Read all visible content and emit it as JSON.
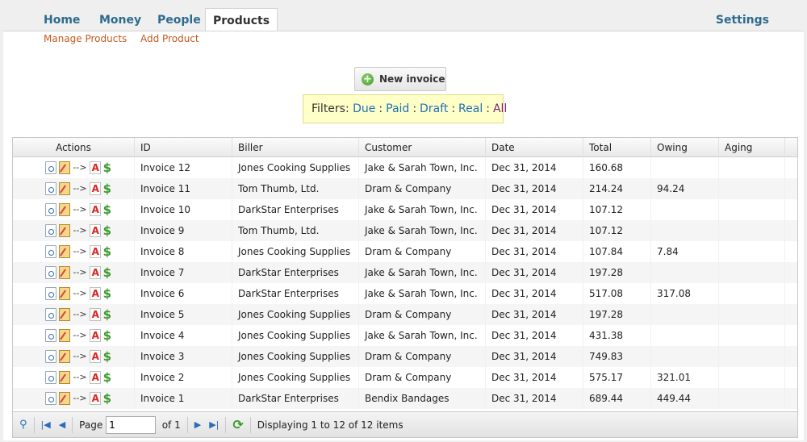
{
  "nav": {
    "tabs": [
      {
        "label": "Home"
      },
      {
        "label": "Money"
      },
      {
        "label": "People"
      },
      {
        "label": "Products"
      }
    ],
    "settings": "Settings",
    "subnav": [
      "Manage Products",
      "Add Product"
    ]
  },
  "new_invoice": "New invoice",
  "filters": {
    "label": "Filters:",
    "options": [
      "Due",
      "Paid",
      "Draft",
      "Real",
      "All"
    ]
  },
  "grid": {
    "columns": [
      "Actions",
      "ID",
      "Biller",
      "Customer",
      "Date",
      "Total",
      "Owing",
      "Aging"
    ],
    "arrow": "-->",
    "rows": [
      {
        "id": "Invoice 12",
        "biller": "Jones Cooking Supplies",
        "customer": "Jake & Sarah Town, Inc.",
        "date": "Dec 31, 2014",
        "total": "160.68",
        "owing": ""
      },
      {
        "id": "Invoice 11",
        "biller": "Tom Thumb, Ltd.",
        "customer": "Dram & Company",
        "date": "Dec 31, 2014",
        "total": "214.24",
        "owing": "94.24"
      },
      {
        "id": "Invoice 10",
        "biller": "DarkStar Enterprises",
        "customer": "Jake & Sarah Town, Inc.",
        "date": "Dec 31, 2014",
        "total": "107.12",
        "owing": ""
      },
      {
        "id": "Invoice 9",
        "biller": "Tom Thumb, Ltd.",
        "customer": "Jake & Sarah Town, Inc.",
        "date": "Dec 31, 2014",
        "total": "107.12",
        "owing": ""
      },
      {
        "id": "Invoice 8",
        "biller": "Jones Cooking Supplies",
        "customer": "Dram & Company",
        "date": "Dec 31, 2014",
        "total": "107.84",
        "owing": "7.84"
      },
      {
        "id": "Invoice 7",
        "biller": "DarkStar Enterprises",
        "customer": "Jake & Sarah Town, Inc.",
        "date": "Dec 31, 2014",
        "total": "197.28",
        "owing": ""
      },
      {
        "id": "Invoice 6",
        "biller": "DarkStar Enterprises",
        "customer": "Jake & Sarah Town, Inc.",
        "date": "Dec 31, 2014",
        "total": "517.08",
        "owing": "317.08"
      },
      {
        "id": "Invoice 5",
        "biller": "Jones Cooking Supplies",
        "customer": "Dram & Company",
        "date": "Dec 31, 2014",
        "total": "197.28",
        "owing": ""
      },
      {
        "id": "Invoice 4",
        "biller": "Jones Cooking Supplies",
        "customer": "Jake & Sarah Town, Inc.",
        "date": "Dec 31, 2014",
        "total": "431.38",
        "owing": ""
      },
      {
        "id": "Invoice 3",
        "biller": "Jones Cooking Supplies",
        "customer": "Dram & Company",
        "date": "Dec 31, 2014",
        "total": "749.83",
        "owing": ""
      },
      {
        "id": "Invoice 2",
        "biller": "Jones Cooking Supplies",
        "customer": "Dram & Company",
        "date": "Dec 31, 2014",
        "total": "575.17",
        "owing": "321.01"
      },
      {
        "id": "Invoice 1",
        "biller": "DarkStar Enterprises",
        "customer": "Bendix Bandages",
        "date": "Dec 31, 2014",
        "total": "689.44",
        "owing": "449.44"
      }
    ]
  },
  "pager": {
    "page_label": "Page",
    "page_value": "1",
    "of_label": "of 1",
    "displaying": "Displaying 1 to 12 of 12 items"
  }
}
